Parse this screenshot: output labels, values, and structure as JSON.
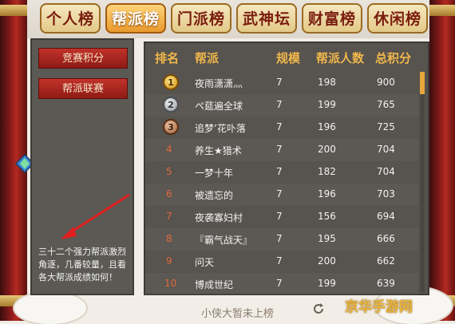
{
  "tabs": [
    {
      "label": "个人榜",
      "active": false
    },
    {
      "label": "帮派榜",
      "active": true
    },
    {
      "label": "门派榜",
      "active": false
    },
    {
      "label": "武神坛",
      "active": false
    },
    {
      "label": "财富榜",
      "active": false
    },
    {
      "label": "休闲榜",
      "active": false
    }
  ],
  "sidebar": {
    "buttons": [
      "竞赛积分",
      "帮派联赛"
    ],
    "hint": "三十二个强力帮派激烈角逐，几番较量，且看各大帮派成绩如何！"
  },
  "table": {
    "headers": {
      "rank": "排名",
      "name": "帮派",
      "scale": "规模",
      "members": "帮派人数",
      "score": "总积分"
    },
    "rows": [
      {
        "rank": "1",
        "name": "夜雨潇潇灬",
        "scale": "7",
        "members": "198",
        "score": "900"
      },
      {
        "rank": "2",
        "name": "ペ莚遍全球",
        "scale": "7",
        "members": "199",
        "score": "765"
      },
      {
        "rank": "3",
        "name": "追梦’花卟落",
        "scale": "7",
        "members": "196",
        "score": "725"
      },
      {
        "rank": "4",
        "name": "养生★猎术",
        "scale": "7",
        "members": "200",
        "score": "704"
      },
      {
        "rank": "5",
        "name": "一梦十年",
        "scale": "7",
        "members": "182",
        "score": "704"
      },
      {
        "rank": "6",
        "name": "被遗忘的",
        "scale": "7",
        "members": "196",
        "score": "703"
      },
      {
        "rank": "7",
        "name": "夜袭寡妇村",
        "scale": "7",
        "members": "156",
        "score": "694"
      },
      {
        "rank": "8",
        "name": "『霸气战天』",
        "scale": "7",
        "members": "195",
        "score": "666"
      },
      {
        "rank": "9",
        "name": "问天",
        "scale": "7",
        "members": "200",
        "score": "662"
      },
      {
        "rank": "10",
        "name": "博成世纪",
        "scale": "7",
        "members": "199",
        "score": "639"
      }
    ]
  },
  "footer": {
    "text": "小侠大暂未上榜"
  },
  "watermark": "京华手游网"
}
